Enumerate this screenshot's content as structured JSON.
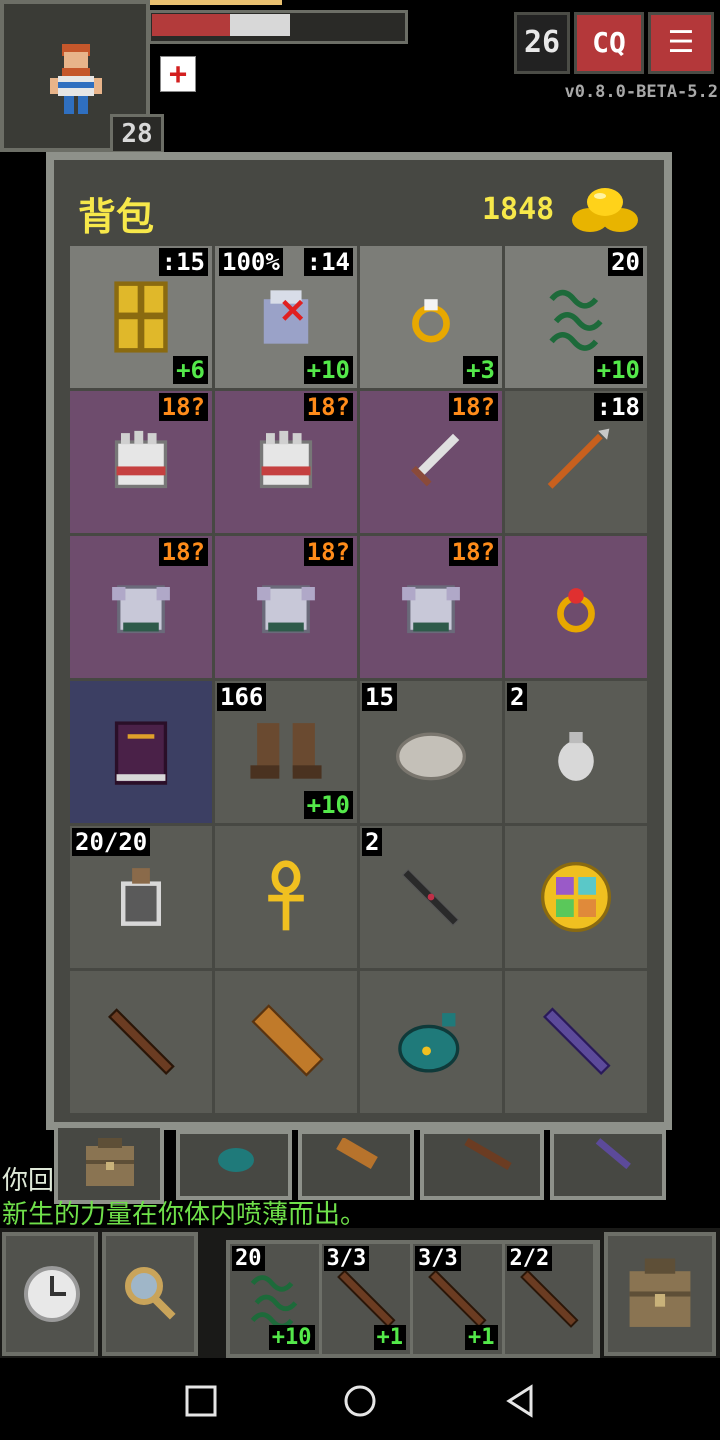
{
  "hud": {
    "depth": "26",
    "level": "28",
    "version": "v0.8.0-BETA-5.2",
    "journal_icon": "journal-icon",
    "menu_icon": "menu-icon",
    "buff_icon": "health-cross-icon"
  },
  "bag": {
    "title": "背包",
    "gold": "1848",
    "rows": [
      [
        {
          "icon": "golden-shield-icon",
          "qty": ":15",
          "upgrade": "+6",
          "bg": "light"
        },
        {
          "icon": "cloak-icon",
          "pct": "100%",
          "qty": ":14",
          "upgrade": "+10",
          "bg": "light"
        },
        {
          "icon": "ring-icon",
          "upgrade": "+3",
          "bg": "light"
        },
        {
          "icon": "chain-icon",
          "qty": "20",
          "upgrade": "+10",
          "bg": "light"
        }
      ],
      [
        {
          "icon": "gauntlet-icon",
          "level": "18?",
          "bg": "cursed"
        },
        {
          "icon": "gauntlet-icon",
          "level": "18?",
          "bg": "cursed"
        },
        {
          "icon": "sword-icon",
          "level": "18?",
          "bg": "cursed"
        },
        {
          "icon": "spear-icon",
          "qty": ":18",
          "bg": "normal"
        }
      ],
      [
        {
          "icon": "armor-icon",
          "level": "18?",
          "bg": "cursed"
        },
        {
          "icon": "armor-icon",
          "level": "18?",
          "bg": "cursed"
        },
        {
          "icon": "armor-icon",
          "level": "18?",
          "bg": "cursed"
        },
        {
          "icon": "ruby-ring-icon",
          "bg": "cursed"
        }
      ],
      [
        {
          "icon": "spellbook-icon",
          "bg": "selected"
        },
        {
          "icon": "boots-icon",
          "qtyLeft": "166",
          "upgrade": "+10",
          "bg": "normal"
        },
        {
          "icon": "stone-icon",
          "qtyLeft": "15",
          "bg": "normal"
        },
        {
          "icon": "pouch-icon",
          "qtyLeft": "2",
          "bg": "normal"
        }
      ],
      [
        {
          "icon": "bottle-icon",
          "qtyLeft": "20/20",
          "bg": "normal"
        },
        {
          "icon": "ankh-icon",
          "bg": "normal"
        },
        {
          "icon": "dart-icon",
          "qtyLeft": "2",
          "bg": "normal"
        },
        {
          "icon": "compass-icon",
          "bg": "normal"
        }
      ],
      [
        {
          "icon": "wand-icon",
          "bg": "normal"
        },
        {
          "icon": "scroll-icon",
          "bg": "normal"
        },
        {
          "icon": "potion-bag-icon",
          "bg": "normal"
        },
        {
          "icon": "purple-wand-icon",
          "bg": "normal"
        }
      ]
    ]
  },
  "log": {
    "line1": "你回",
    "line2": "新生的力量在你体内喷薄而出。"
  },
  "toolbar": {
    "wait_icon": "clock-icon",
    "search_icon": "magnifier-icon",
    "backpack_icon": "backpack-icon",
    "quickslots": [
      {
        "icon": "chain-icon",
        "qty": "20",
        "upgrade": "+10"
      },
      {
        "icon": "wand-icon",
        "qty": "3/3",
        "upgrade": "+1"
      },
      {
        "icon": "wand-icon",
        "qty": "3/3",
        "upgrade": "+1"
      },
      {
        "icon": "wand-icon",
        "qty": "2/2"
      }
    ]
  },
  "colors": {
    "gold_text": "#f7e84a",
    "upgrade_green": "#54e84a",
    "unknown_level_orange": "#ff8c1a",
    "cursed_slot": "#6e4c6d",
    "menu_red": "#b4383a"
  }
}
